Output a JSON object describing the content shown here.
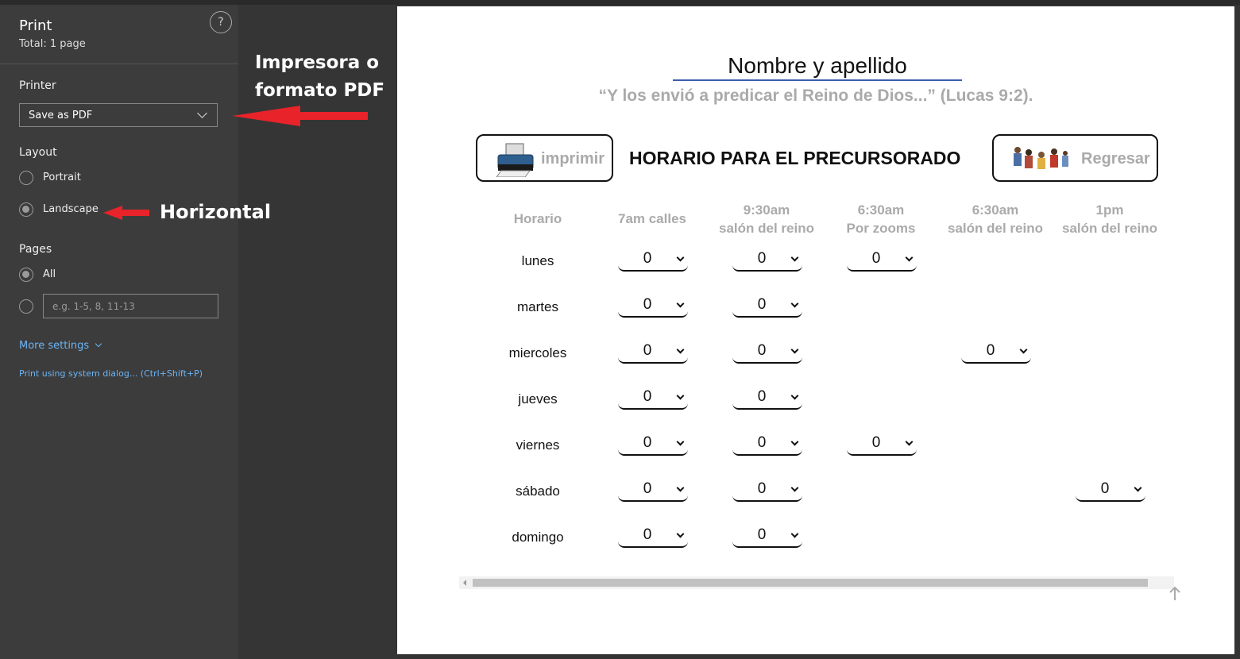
{
  "print_panel": {
    "title": "Print",
    "total": "Total: 1 page",
    "help": "?",
    "printer_label": "Printer",
    "printer_value": "Save as PDF",
    "layout_label": "Layout",
    "layout_options": [
      "Portrait",
      "Landscape"
    ],
    "layout_selected": "Landscape",
    "pages_label": "Pages",
    "pages_all": "All",
    "pages_placeholder": "e.g. 1-5, 8, 11-13",
    "more_settings": "More settings",
    "system_dialog": "Print using system dialog... (Ctrl+Shift+P)"
  },
  "annotations": {
    "printer_note": "Impresora o formato PDF",
    "printer_note_line1": "Impresora o",
    "printer_note_line2": "formato PDF",
    "layout_note": "Horizontal",
    "arrow_color": "#e8232a"
  },
  "preview": {
    "name_field": "Nombre y apellido",
    "quote": "“Y los envió a predicar el Reino de Dios...” (Lucas 9:2).",
    "print_button": "imprimir",
    "heading": "HORARIO PARA EL PRECURSORADO",
    "back_button": "Regresar",
    "columns": [
      {
        "line1": "Horario",
        "line2": ""
      },
      {
        "line1": "7am calles",
        "line2": ""
      },
      {
        "line1": "9:30am",
        "line2": "salón del reino"
      },
      {
        "line1": "6:30am",
        "line2": "Por zooms"
      },
      {
        "line1": "6:30am",
        "line2": "salón del reino"
      },
      {
        "line1": "1pm",
        "line2": "salón del reino"
      }
    ],
    "rows": [
      {
        "day": "lunes",
        "cells": [
          "0",
          "0",
          "0",
          null,
          null
        ]
      },
      {
        "day": "martes",
        "cells": [
          "0",
          "0",
          null,
          null,
          null
        ]
      },
      {
        "day": "miercoles",
        "cells": [
          "0",
          "0",
          null,
          "0",
          null
        ]
      },
      {
        "day": "jueves",
        "cells": [
          "0",
          "0",
          null,
          null,
          null
        ]
      },
      {
        "day": "viernes",
        "cells": [
          "0",
          "0",
          "0",
          null,
          null
        ]
      },
      {
        "day": "sábado",
        "cells": [
          "0",
          "0",
          null,
          null,
          "0"
        ]
      },
      {
        "day": "domingo",
        "cells": [
          "0",
          "0",
          null,
          null,
          null
        ]
      }
    ]
  }
}
